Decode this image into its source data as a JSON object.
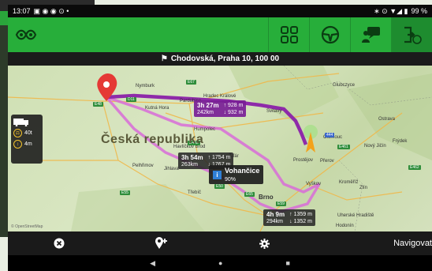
{
  "status": {
    "time": "13:07",
    "battery": "99 %"
  },
  "address": "Chodovská, Praha 10, 100 00",
  "map": {
    "country": "Česká republika",
    "towns": [
      "Nymburk",
      "Kutná Hora",
      "Pardubice",
      "Hradec Králové",
      "Humpolec",
      "Pelhřimov",
      "Jihlava",
      "Třebíč",
      "Brno",
      "Prostějov",
      "Přerov",
      "Kroměříž",
      "Zlín",
      "Vyškov",
      "Olomouc",
      "Ostrava",
      "Nový Jičín",
      "Frýdek",
      "Uherské Hradiště",
      "Hodonín",
      "Glubczyce",
      "Svitavy",
      "Havlíčkův Brod",
      "Žďár"
    ],
    "highways": [
      "E48",
      "E67",
      "D11",
      "E442",
      "E65",
      "E50",
      "E55",
      "E59",
      "E461",
      "444",
      "E462"
    ],
    "copyright": "© OpenStreetMap"
  },
  "routes": [
    {
      "time": "3h 27m",
      "dist": "242km",
      "climb": "↑ 928 m",
      "descent": "↓ 932 m",
      "selected": true
    },
    {
      "time": "3h 54m",
      "dist": "263km",
      "climb": "↑ 1754 m",
      "descent": "↓ 1767 m",
      "selected": false
    },
    {
      "time": "4h 9m",
      "dist": "294km",
      "climb": "↑ 1359 m",
      "descent": "↓ 1352 m",
      "selected": false
    }
  ],
  "truck": {
    "weight": "40t",
    "height": "4m"
  },
  "poi": {
    "name": "Vohančice",
    "percent": "90%"
  },
  "bottom": {
    "navigate": "Navigovat"
  },
  "colors": {
    "brand_green": "#27ae3a",
    "route_selected": "#8e2aa9",
    "route_alt": "#d86cd8"
  }
}
